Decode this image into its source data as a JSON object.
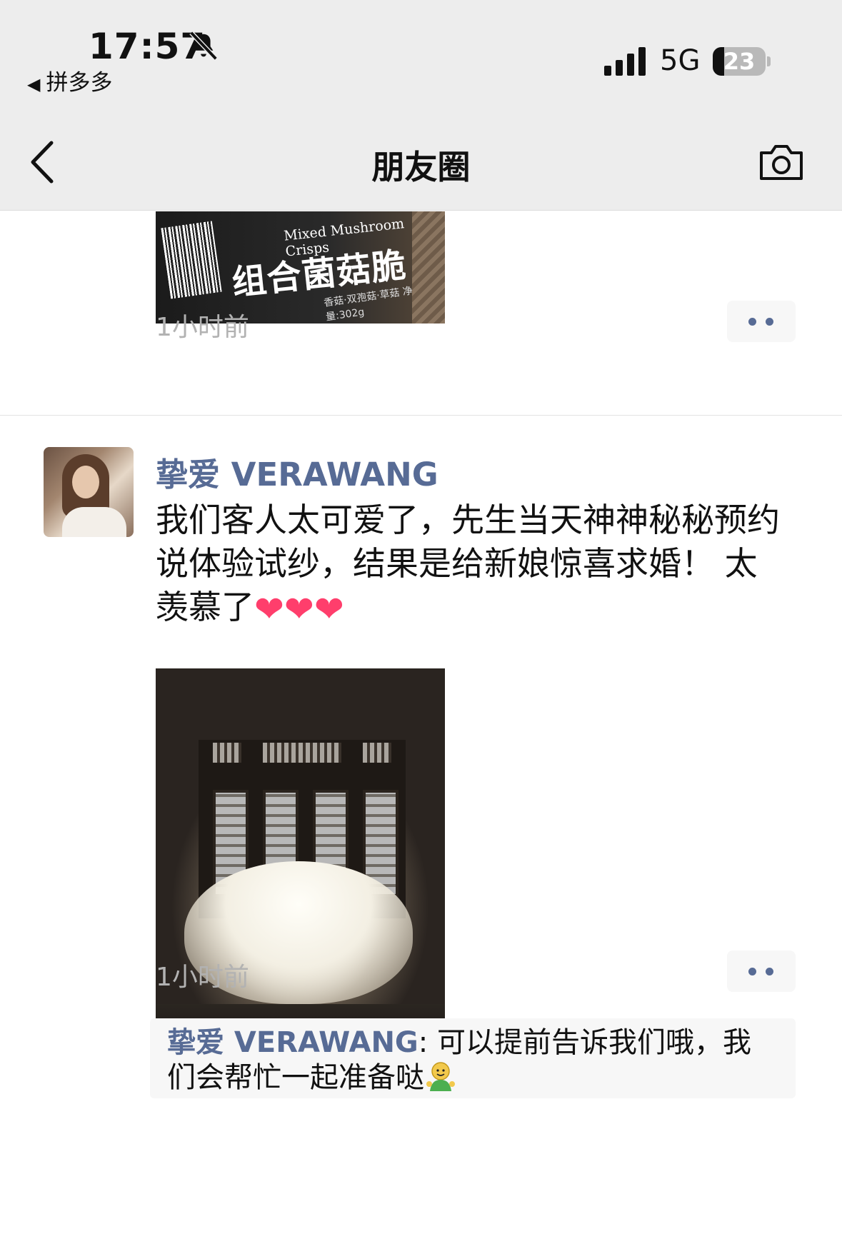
{
  "status_bar": {
    "time": "17:57",
    "back_app": "拼多多",
    "network": "5G",
    "battery": "23",
    "icons": [
      "bell-slash-icon",
      "signal-icon",
      "battery-icon"
    ]
  },
  "nav": {
    "title": "朋友圈",
    "icons": [
      "back-chevron-icon",
      "camera-icon"
    ]
  },
  "previous_post": {
    "image_text_en": "Mixed Mushroom Crisps",
    "image_text_cn": "组合菌菇脆",
    "image_text_small": "香菇·双孢菇·草菇 净含量:302g",
    "time": "1小时前"
  },
  "post": {
    "author": "挚爱 VERAWANG",
    "text": "我们客人太可爱了，先生当天神神秘秘预约说体验试纱，结果是给新娘惊喜求婚！ 太羡慕了",
    "hearts": [
      "❤",
      "❤",
      "❤"
    ],
    "time": "1小时前",
    "photo": "bride-in-window-photo"
  },
  "comment": {
    "name": "挚爱 VERAWANG",
    "separator": ": ",
    "text": "可以提前告诉我们哦，我们会帮忙一起准备哒",
    "emoji": "smile-emoji-icon"
  },
  "colors": {
    "link": "#576b95",
    "time": "#b2b2b2",
    "bar_bg": "#ededed"
  }
}
